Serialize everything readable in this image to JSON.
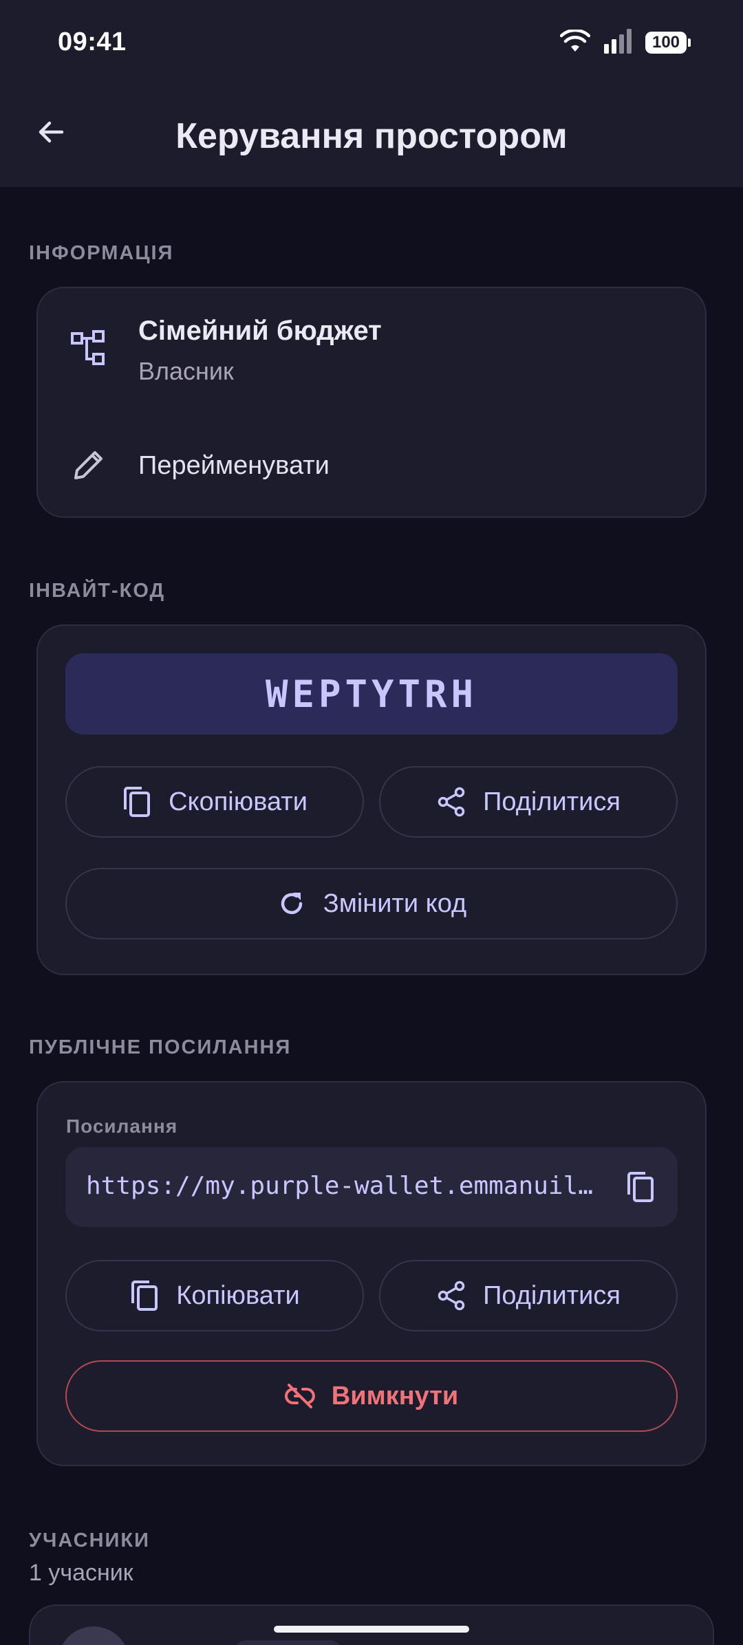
{
  "status_bar": {
    "time": "09:41",
    "battery": "100"
  },
  "app_bar": {
    "title": "Керування простором"
  },
  "info_section": {
    "label": "ІНФОРМАЦІЯ",
    "space_name": "Сімейний бюджет",
    "role": "Власник",
    "rename_label": "Перейменувати"
  },
  "invite_section": {
    "label": "ІНВАЙТ-КОД",
    "code": "WEPTYTRH",
    "copy_label": "Скопіювати",
    "share_label": "Поділитися",
    "regenerate_label": "Змінити код"
  },
  "public_link_section": {
    "label": "ПУБЛІЧНЕ ПОСИЛАННЯ",
    "caption": "Посилання",
    "url": "https://my.purple-wallet.emmanuil…",
    "copy_label": "Копіювати",
    "share_label": "Поділитися",
    "disable_label": "Вимкнути"
  },
  "members_section": {
    "label": "УЧАСНИКИ",
    "count": "1 учасник"
  },
  "colors": {
    "background": "#0f0f1e",
    "surface": "#1c1c2d",
    "accent": "#c9c5ff",
    "code_background": "#2c2a58",
    "danger": "#f07378"
  }
}
